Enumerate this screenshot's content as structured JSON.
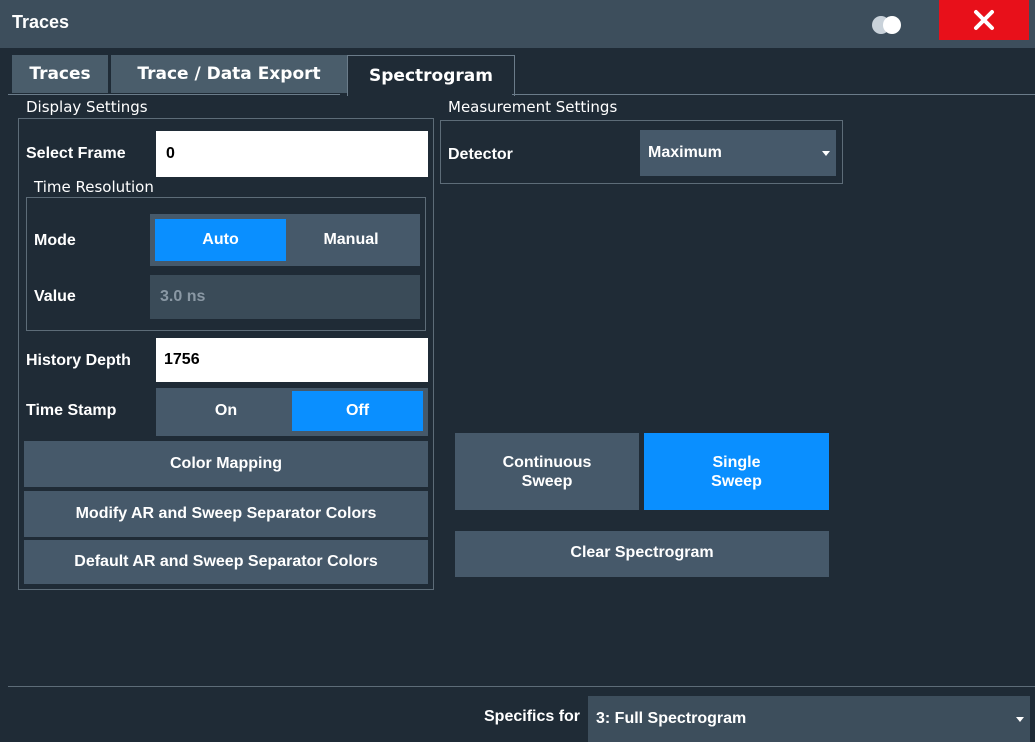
{
  "window": {
    "title": "Traces"
  },
  "tabs": [
    {
      "label": "Traces"
    },
    {
      "label": "Trace / Data Export"
    },
    {
      "label": "Spectrogram"
    }
  ],
  "active_tab": "Spectrogram",
  "display_settings": {
    "group_label": "Display Settings",
    "select_frame": {
      "label": "Select Frame",
      "value": "0"
    },
    "time_resolution": {
      "group_label": "Time Resolution",
      "mode": {
        "label": "Mode",
        "options": [
          "Auto",
          "Manual"
        ],
        "selected": "Auto"
      },
      "value": {
        "label": "Value",
        "value": "3.0 ns"
      }
    },
    "history_depth": {
      "label": "History Depth",
      "value": "1756"
    },
    "time_stamp": {
      "label": "Time Stamp",
      "options": [
        "On",
        "Off"
      ],
      "selected": "Off"
    },
    "buttons": {
      "color_mapping": "Color Mapping",
      "modify_colors": "Modify AR and Sweep Separator Colors",
      "default_colors": "Default AR and Sweep Separator Colors"
    }
  },
  "measurement_settings": {
    "group_label": "Measurement Settings",
    "detector": {
      "label": "Detector",
      "value": "Maximum"
    }
  },
  "sweep": {
    "continuous_line1": "Continuous",
    "continuous_line2": "Sweep",
    "single_line1": "Single",
    "single_line2": "Sweep",
    "clear": "Clear Spectrogram"
  },
  "footer": {
    "specifics_label": "Specifics for",
    "specifics_value": "3: Full Spectrogram"
  },
  "colors": {
    "background": "#1f2b36",
    "accent": "#0a8fff",
    "close": "#e8101a",
    "control": "#46596a"
  }
}
